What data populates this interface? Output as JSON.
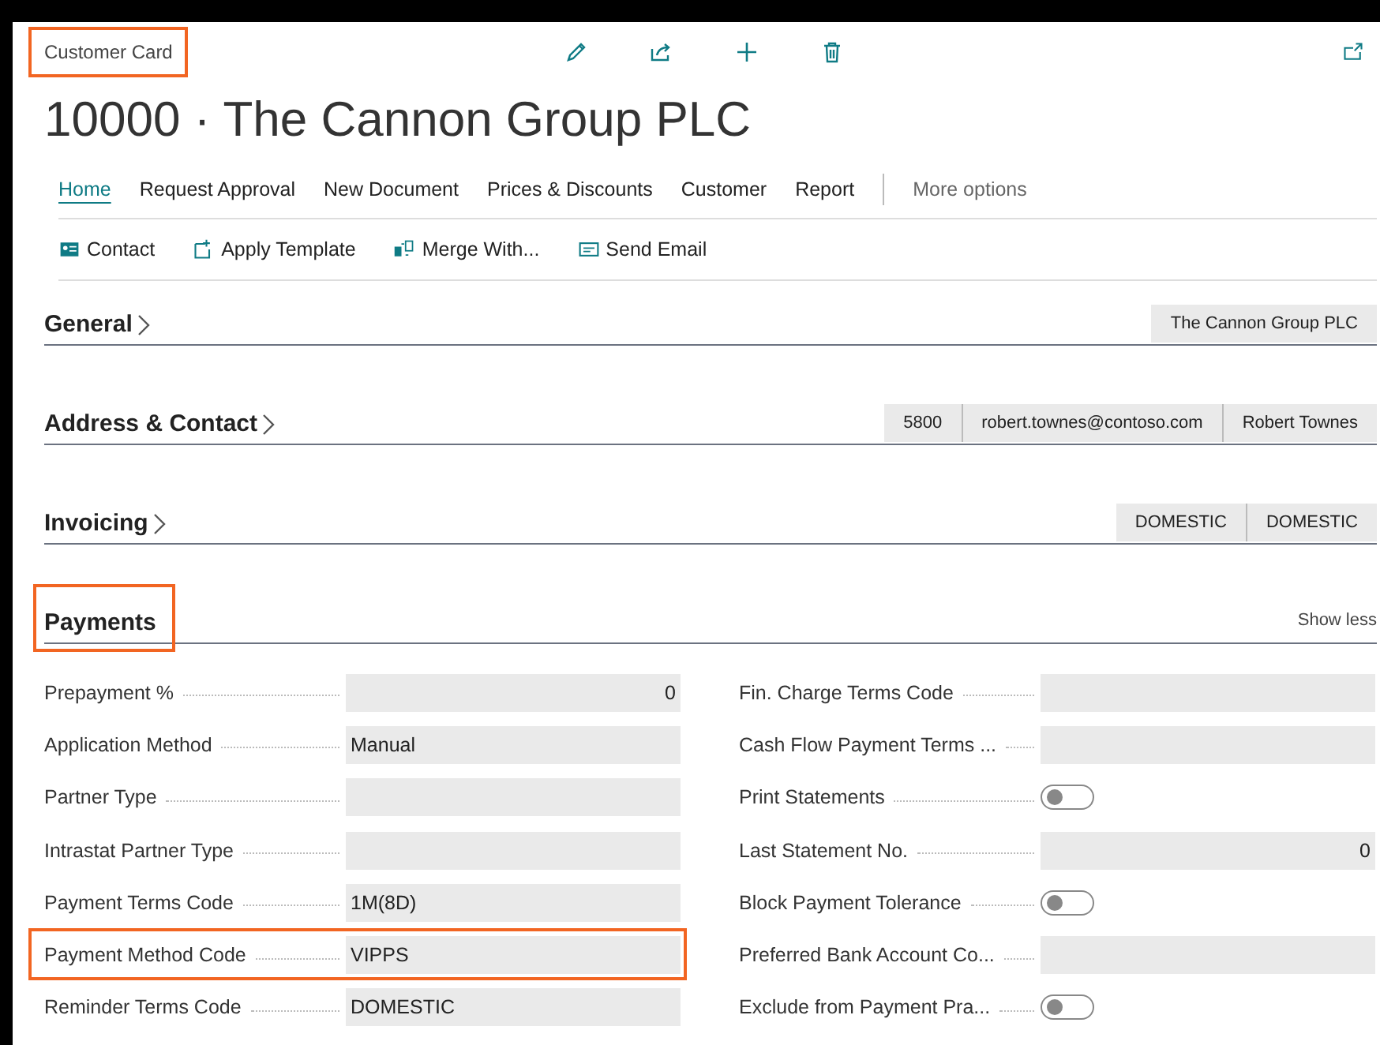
{
  "header": {
    "caption": "Customer Card",
    "caption_highlighted": true,
    "title": "10000 · The Cannon Group PLC"
  },
  "toolbar_icons": [
    {
      "kind": "edit"
    },
    {
      "kind": "share"
    },
    {
      "kind": "new"
    },
    {
      "kind": "delete"
    }
  ],
  "menu": [
    {
      "label": "Home",
      "selected": true,
      "kind": "tab"
    },
    {
      "label": "Request Approval",
      "selected": false,
      "kind": "tab"
    },
    {
      "label": "New Document",
      "selected": false,
      "kind": "tab"
    },
    {
      "label": "Prices & Discounts",
      "selected": false,
      "kind": "tab"
    },
    {
      "label": "Customer",
      "selected": false,
      "kind": "tab"
    },
    {
      "label": "Report",
      "selected": false,
      "kind": "tab"
    },
    {
      "label": "More options",
      "selected": false,
      "kind": "more"
    }
  ],
  "actions": [
    {
      "label": "Contact",
      "kind": "contact"
    },
    {
      "label": "Apply Template",
      "kind": "template"
    },
    {
      "label": "Merge With...",
      "kind": "merge"
    },
    {
      "label": "Send Email",
      "kind": "email"
    }
  ],
  "sections": [
    {
      "title": "General",
      "expanded": false,
      "highlighted": false,
      "summary": [
        "The Cannon Group PLC"
      ]
    },
    {
      "title": "Address & Contact",
      "expanded": false,
      "highlighted": false,
      "summary": [
        "5800",
        "robert.townes@contoso.com",
        "Robert Townes"
      ]
    },
    {
      "title": "Invoicing",
      "expanded": false,
      "highlighted": false,
      "summary": [
        "DOMESTIC",
        "DOMESTIC"
      ]
    },
    {
      "title": "Payments",
      "expanded": true,
      "highlighted": true,
      "toggle_label": "Show less",
      "fields_left": [
        {
          "label": "Prepayment %",
          "kind": "number",
          "value": "0",
          "highlighted": false
        },
        {
          "label": "Application Method",
          "kind": "text",
          "value": "Manual",
          "highlighted": false
        },
        {
          "label": "Partner Type",
          "kind": "text",
          "highlighted": false
        },
        {
          "label": "Intrastat Partner Type",
          "kind": "text",
          "highlighted": false
        },
        {
          "label": "Payment Terms Code",
          "kind": "text",
          "value": "1M(8D)",
          "highlighted": false
        },
        {
          "label": "Payment Method Code",
          "kind": "text",
          "value": "VIPPS",
          "highlighted": true
        },
        {
          "label": "Reminder Terms Code",
          "kind": "text",
          "value": "DOMESTIC",
          "highlighted": false
        }
      ],
      "fields_right": [
        {
          "label": "Fin. Charge Terms Code",
          "kind": "text",
          "highlighted": false
        },
        {
          "label": "Cash Flow Payment Terms ...",
          "kind": "text",
          "highlighted": false
        },
        {
          "label": "Print Statements",
          "kind": "toggle",
          "on": false,
          "highlighted": false
        },
        {
          "label": "Last Statement No.",
          "kind": "number",
          "value": "0",
          "highlighted": false
        },
        {
          "label": "Block Payment Tolerance",
          "kind": "toggle",
          "on": false,
          "highlighted": false
        },
        {
          "label": "Preferred Bank Account Co...",
          "kind": "text",
          "highlighted": false
        },
        {
          "label": "Exclude from Payment Pra...",
          "kind": "toggle",
          "on": false,
          "highlighted": false
        }
      ]
    }
  ]
}
